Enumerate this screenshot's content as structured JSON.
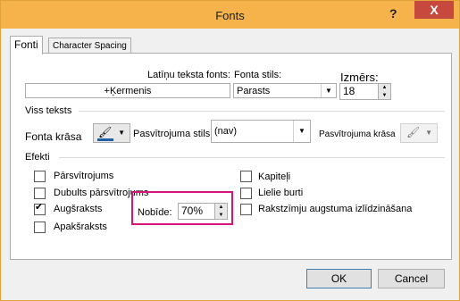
{
  "window": {
    "title": "Fonts",
    "help_label": "?",
    "close_label": "X"
  },
  "tabs": [
    {
      "label": "Fonti"
    },
    {
      "label": "Character Spacing"
    }
  ],
  "font": {
    "latin_label": "Latīņu teksta fonts:",
    "latin_value": "+Ķermenis",
    "style_label": "Fonta stils:",
    "style_value": "Parasts",
    "size_label": "Izmērs:",
    "size_value": "18"
  },
  "all_text": {
    "group_label": "Viss teksts",
    "font_color_label": "Fonta krāsa",
    "underline_style_label": "Pasvītrojuma stils",
    "underline_style_value": "(nav)",
    "underline_color_label": "Pasvītrojuma krāsa"
  },
  "effects": {
    "group_label": "Efekti",
    "left": [
      {
        "label": "Pārsvītrojums",
        "checked": false
      },
      {
        "label": "Dubults pārsvītrojums",
        "checked": false
      },
      {
        "label": "Augšraksts",
        "checked": true
      },
      {
        "label": "Apakšraksts",
        "checked": false
      }
    ],
    "right": [
      {
        "label": "Kapiteļi",
        "checked": false
      },
      {
        "label": "Lielie burti",
        "checked": false
      },
      {
        "label": "Rakstzīmju augstuma izlīdzināšana",
        "checked": false
      }
    ],
    "offset_label": "Nobīde:",
    "offset_value": "70%"
  },
  "buttons": {
    "ok_label": "OK",
    "cancel_label": "Cancel"
  },
  "colors": {
    "title_bar": "#f6b24b",
    "close_button": "#c7483d",
    "highlight": "#d6157a"
  }
}
